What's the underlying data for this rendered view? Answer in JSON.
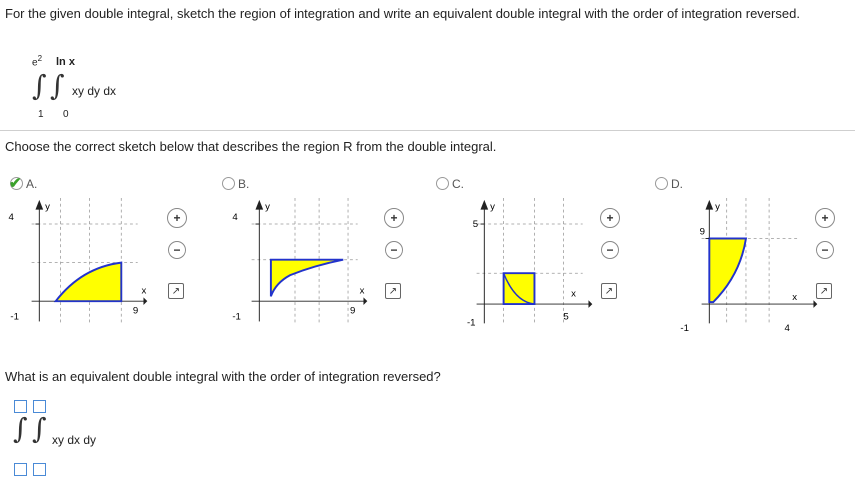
{
  "question": "For the given double integral, sketch the region of integration and write an equivalent double integral with the order of integration reversed.",
  "integral": {
    "outer_upper": "e",
    "outer_upper_exp": "2",
    "inner_upper": "ln x",
    "outer_lower": "1",
    "inner_lower": "0",
    "integrand": "xy dy dx"
  },
  "choose_prompt": "Choose the correct sketch below that describes the region R from the double integral.",
  "options": [
    {
      "label": "A.",
      "selected": true,
      "y_top": "4",
      "y_bottom": "-1",
      "x_right": "9",
      "x_left": "",
      "x_axis": "x",
      "y_axis": "y"
    },
    {
      "label": "B.",
      "selected": false,
      "y_top": "4",
      "y_bottom": "-1",
      "x_right": "9",
      "x_left": "",
      "x_axis": "x",
      "y_axis": "y"
    },
    {
      "label": "C.",
      "selected": false,
      "y_top": "5",
      "y_bottom": "",
      "x_right": "5",
      "x_left": "-1",
      "x_axis": "x",
      "y_axis": "y"
    },
    {
      "label": "D.",
      "selected": false,
      "y_top": "9",
      "y_bottom": "",
      "x_right": "4",
      "x_left": "-1",
      "x_axis": "x",
      "y_axis": "y"
    }
  ],
  "icons": {
    "zoom_in": "zoom-in-icon",
    "zoom_out": "zoom-out-icon",
    "popout": "popout-icon",
    "check": "check-icon"
  },
  "colors": {
    "fill": "#ffff00",
    "outline": "#2233cc",
    "check": "#3aa02b",
    "blank_border": "#4a8ad6"
  },
  "question2": "What is an equivalent double integral with the order of integration reversed?",
  "answer": {
    "integrand": "xy dx dy"
  }
}
